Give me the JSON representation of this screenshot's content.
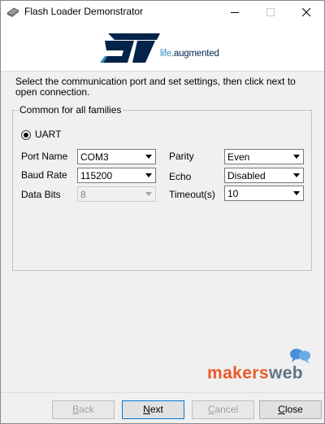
{
  "window": {
    "title": "Flash Loader Demonstrator"
  },
  "banner": {
    "tagline_a": "life",
    "tagline_b": ".augmented"
  },
  "instruction": "Select the communication port and set settings, then click next to open connection.",
  "group": {
    "title": "Common for all families",
    "radio_label": "UART",
    "radio_selected": true,
    "fields": {
      "port_name": {
        "label": "Port Name",
        "value": "COM3"
      },
      "baud_rate": {
        "label": "Baud Rate",
        "value": "115200"
      },
      "data_bits": {
        "label": "Data Bits",
        "value": "8",
        "disabled": true
      },
      "parity": {
        "label": "Parity",
        "value": "Even"
      },
      "echo": {
        "label": "Echo",
        "value": "Disabled"
      },
      "timeout": {
        "label": "Timeout(s)",
        "value": "10"
      }
    }
  },
  "watermark": {
    "part_a": "makers",
    "part_b": "web"
  },
  "buttons": {
    "back": {
      "mnemonic": "B",
      "rest": "ack",
      "disabled": true
    },
    "next": {
      "mnemonic": "N",
      "rest": "ext"
    },
    "cancel": {
      "mnemonic": "C",
      "rest": "ancel",
      "disabled": true
    },
    "close": {
      "mnemonic": "C",
      "rest": "lose"
    }
  },
  "colors": {
    "st_blue": "#03234b",
    "tagline": "#2b8fbf",
    "makers": "#ea5a2b",
    "web": "#5d7584",
    "bubble": "#4a90d9"
  },
  "icons": [
    "app-chip-icon",
    "minimize-icon",
    "maximize-icon",
    "close-icon",
    "st-logo",
    "chat-bubbles-icon",
    "dropdown-arrow-icon"
  ]
}
